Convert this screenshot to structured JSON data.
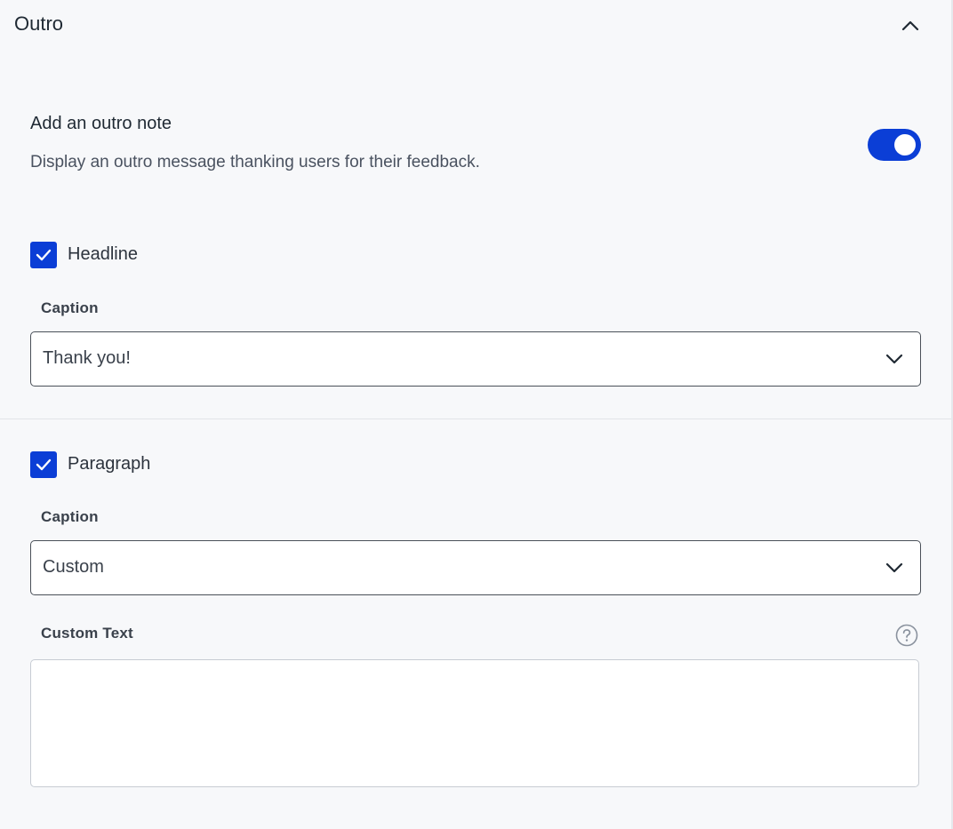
{
  "section": {
    "title": "Outro"
  },
  "outro_note": {
    "title": "Add an outro note",
    "description": "Display an outro message thanking users for their feedback.",
    "enabled": true
  },
  "headline": {
    "checkbox_label": "Headline",
    "checked": true,
    "caption_label": "Caption",
    "caption_value": "Thank you!"
  },
  "paragraph": {
    "checkbox_label": "Paragraph",
    "checked": true,
    "caption_label": "Caption",
    "caption_value": "Custom",
    "custom_text_label": "Custom Text",
    "custom_text_value": ""
  },
  "colors": {
    "accent": "#0b3ed6",
    "background": "#f7f8fa"
  },
  "icons": {
    "collapse": "chevron-up-icon",
    "dropdown": "chevron-down-icon",
    "checkbox": "check-icon",
    "help": "help-circle-icon"
  }
}
